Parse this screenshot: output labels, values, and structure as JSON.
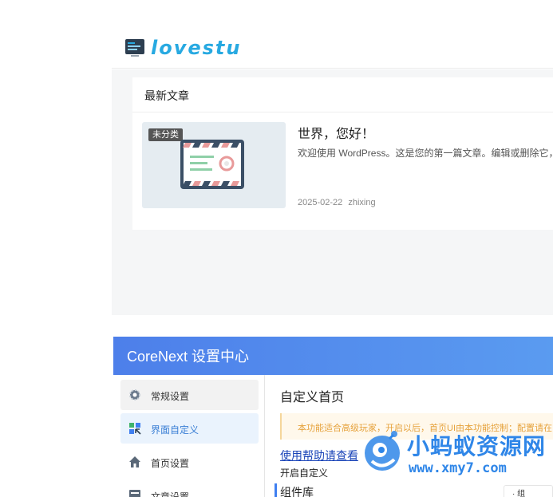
{
  "site": {
    "logo_text": "lovestu"
  },
  "latest": {
    "heading": "最新文章",
    "post": {
      "badge": "未分类",
      "title": "世界，您好！",
      "excerpt": "欢迎使用 WordPress。这是您的第一篇文章。编辑或删除它，然",
      "date": "2025-02-22",
      "author": "zhixing"
    }
  },
  "settings": {
    "title": "CoreNext 设置中心",
    "nav": [
      {
        "label": "常规设置",
        "icon": "gear-icon"
      },
      {
        "label": "界面自定义",
        "icon": "layout-icon"
      },
      {
        "label": "首页设置",
        "icon": "home-icon"
      },
      {
        "label": "文章设置",
        "icon": "article-icon"
      }
    ],
    "main": {
      "title": "自定义首页",
      "notice": "本功能适合高级玩家，开启以后，首页UI由本功能控制；配置请在",
      "help_link": "使用帮助请查看",
      "enable_label": "开启自定义",
      "library_label": "组件库",
      "mini_tab": "· 组"
    }
  },
  "watermark": {
    "cn": "小蚂蚁资源网",
    "url": "www.xmy7.com"
  },
  "colors": {
    "accent": "#4d7fea",
    "logo": "#27a9e1",
    "notice_text": "#e6a23c",
    "link": "#1a44b8"
  }
}
